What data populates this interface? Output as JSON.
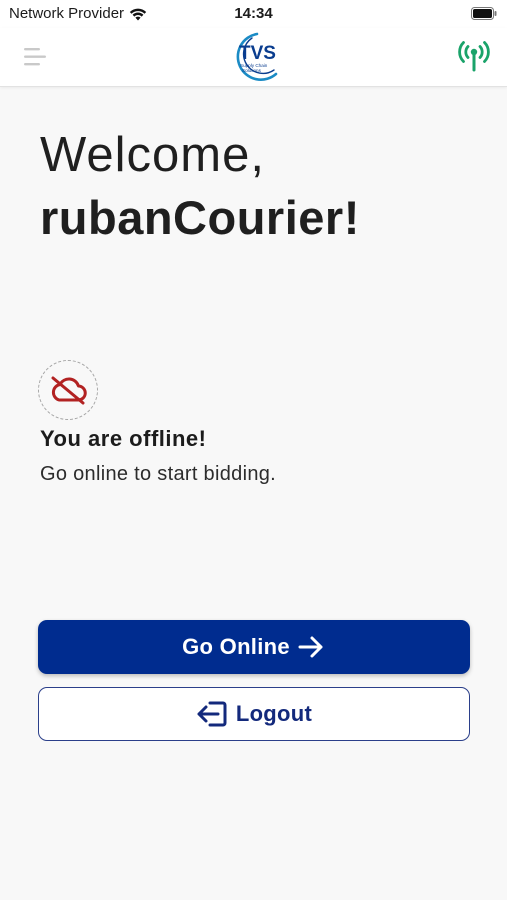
{
  "status_bar": {
    "carrier": "Network Provider",
    "time": "14:34"
  },
  "header": {
    "menu_icon": "menu-icon",
    "logo": {
      "brand": "TVS",
      "tagline_line1": "Supply Chain",
      "tagline_line2": "Solutions"
    },
    "signal_icon": "broadcast-signal-icon",
    "signal_color": "#1aa36a"
  },
  "greeting": {
    "line1": "Welcome,",
    "line2": "rubanCourier!"
  },
  "offline": {
    "icon": "cloud-off-icon",
    "icon_color": "#b22222",
    "title": "You are offline!",
    "subtitle": "Go online to start bidding."
  },
  "actions": {
    "go_online_label": "Go Online",
    "go_online_icon": "arrow-right-icon",
    "logout_label": "Logout",
    "logout_icon": "logout-icon"
  },
  "colors": {
    "primary": "#002c8f",
    "outline": "#2b3f8a",
    "background": "#f8f8f8"
  }
}
